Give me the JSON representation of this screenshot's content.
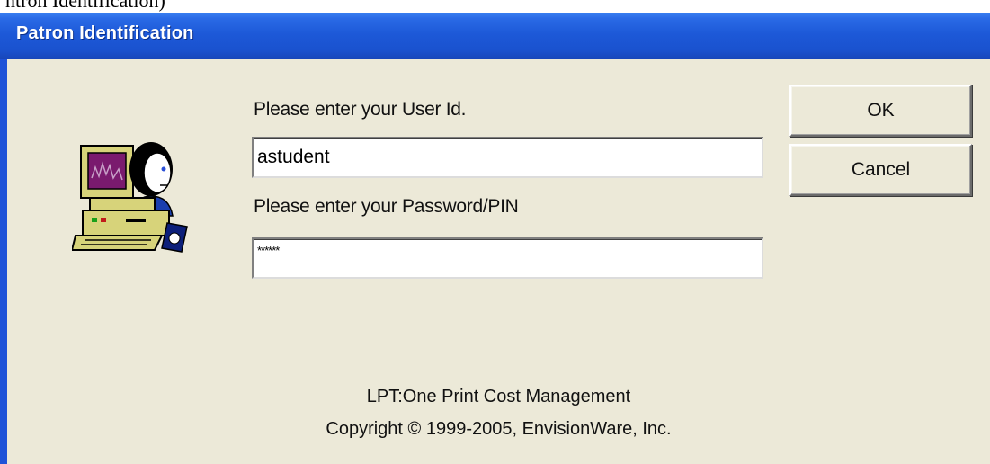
{
  "background_text": "ntron Identification)",
  "dialog": {
    "title": "Patron Identification"
  },
  "form": {
    "user_id_label": "Please enter your User Id.",
    "user_id_value": "astudent",
    "password_label": "Please enter your Password/PIN",
    "password_value": "******"
  },
  "buttons": {
    "ok": "OK",
    "cancel": "Cancel"
  },
  "footer": {
    "product": "LPT:One Print Cost Management",
    "copyright": "Copyright © 1999-2005, EnvisionWare, Inc."
  },
  "icons": {
    "app_icon": "patron-computer-icon"
  },
  "colors": {
    "titlebar": "#1d59d8",
    "dialog_bg": "#ece9d8"
  }
}
